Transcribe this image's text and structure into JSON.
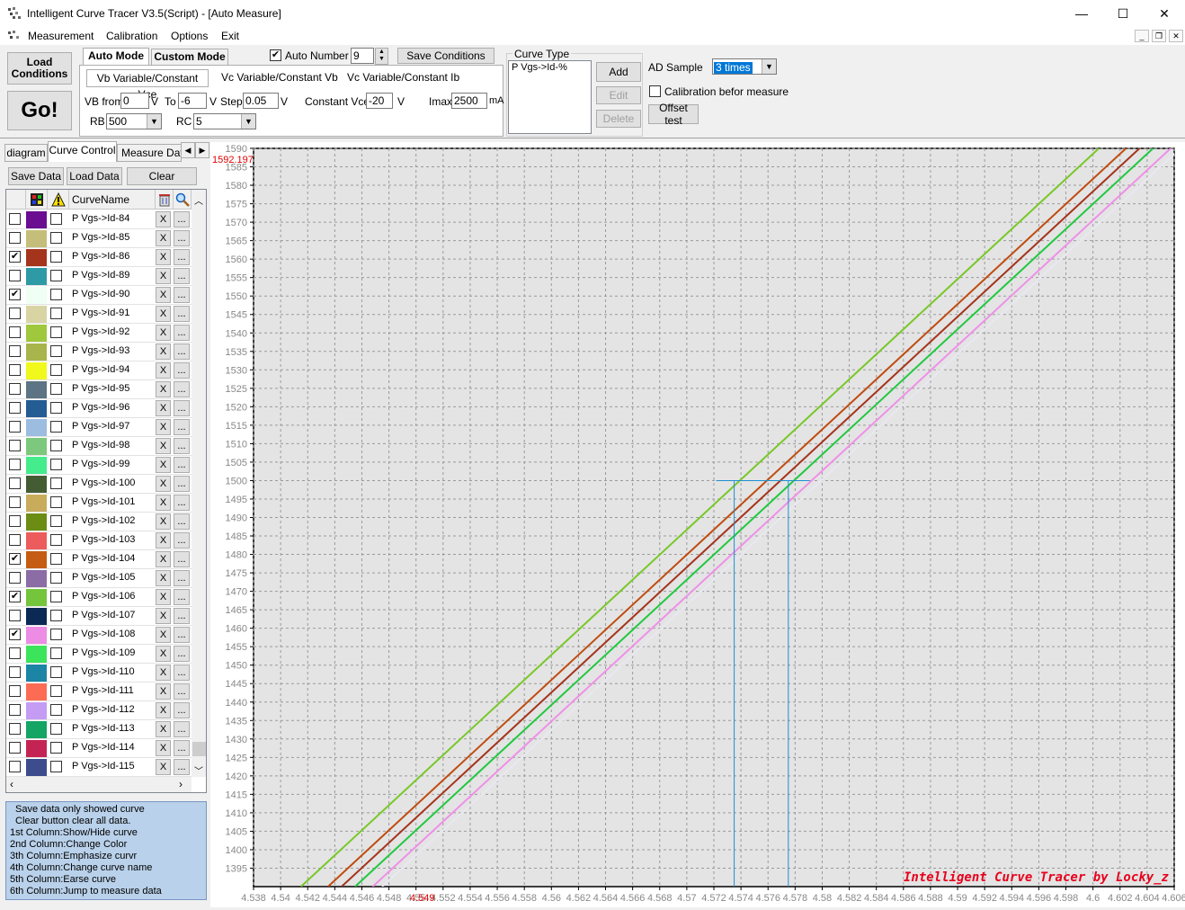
{
  "window": {
    "title": "Intelligent Curve Tracer V3.5(Script) - [Auto Measure]",
    "minimize": "—",
    "maximize": "☐",
    "close": "✕"
  },
  "menu": [
    "Measurement",
    "Calibration",
    "Options",
    "Exit"
  ],
  "toolbar": {
    "load_conditions": "Load Conditions",
    "go": "Go!",
    "auto_mode": "Auto Mode",
    "custom_mode": "Custom Mode",
    "auto_number_label": "Auto Number",
    "auto_number_checked": true,
    "auto_number_value": "9",
    "save_conditions": "Save Conditions",
    "mode_tabs": [
      "Vb Variable/Constant Vce",
      "Vc Variable/Constant Vb",
      "Vc Variable/Constant Ib"
    ],
    "vb_from_label": "VB from",
    "vb_from": "0",
    "v1": "V",
    "to_label": "To",
    "to_value": "-6",
    "v2": "V",
    "step_label": "Step",
    "step_value": "0.05",
    "v3": "V",
    "constant_vce_label": "Constant Vce",
    "constant_vce": "-20",
    "v4": "V",
    "imax_label": "Imax",
    "imax": "2500",
    "imax_unit": "mA",
    "rb_label": "RB",
    "rb_value": "500",
    "rc_label": "RC",
    "rc_value": "5",
    "curve_type_title": "Curve Type",
    "curve_type_item": "P Vgs->Id-%",
    "add": "Add",
    "edit": "Edit",
    "delete": "Delete",
    "ad_sample_label": "AD Sample",
    "ad_sample_value": "3 times",
    "calibration_label": "Calibration befor measure",
    "offset_test": "Offset test"
  },
  "left_tabs": [
    "diagram",
    "Curve Control",
    "Measure Data"
  ],
  "left_buttons": {
    "save_data": "Save Data",
    "load_data": "Load Data",
    "clear": "Clear"
  },
  "grid_header": {
    "name": "CurveName"
  },
  "curves": [
    {
      "name": "P Vgs->Id-84",
      "color": "#6a0d91",
      "checked": false
    },
    {
      "name": "P Vgs->Id-85",
      "color": "#c4be7a",
      "checked": false
    },
    {
      "name": "P Vgs->Id-86",
      "color": "#a4341c",
      "checked": true
    },
    {
      "name": "P Vgs->Id-89",
      "color": "#2e9aa6",
      "checked": false
    },
    {
      "name": "P Vgs->Id-90",
      "color": "#f0fff4",
      "checked": true
    },
    {
      "name": "P Vgs->Id-91",
      "color": "#d8d4a4",
      "checked": false
    },
    {
      "name": "P Vgs->Id-92",
      "color": "#a0c83c",
      "checked": false
    },
    {
      "name": "P Vgs->Id-93",
      "color": "#a8b44c",
      "checked": false
    },
    {
      "name": "P Vgs->Id-94",
      "color": "#f0f81c",
      "checked": false
    },
    {
      "name": "P Vgs->Id-95",
      "color": "#5c7484",
      "checked": false
    },
    {
      "name": "P Vgs->Id-96",
      "color": "#245c94",
      "checked": false
    },
    {
      "name": "P Vgs->Id-97",
      "color": "#9cbce0",
      "checked": false
    },
    {
      "name": "P Vgs->Id-98",
      "color": "#7cc87c",
      "checked": false
    },
    {
      "name": "P Vgs->Id-99",
      "color": "#44ec8c",
      "checked": false
    },
    {
      "name": "P Vgs->Id-100",
      "color": "#445c34",
      "checked": false
    },
    {
      "name": "P Vgs->Id-101",
      "color": "#c8ac5c",
      "checked": false
    },
    {
      "name": "P Vgs->Id-102",
      "color": "#6c8c14",
      "checked": false
    },
    {
      "name": "P Vgs->Id-103",
      "color": "#ec5c5c",
      "checked": false
    },
    {
      "name": "P Vgs->Id-104",
      "color": "#c45c14",
      "checked": true
    },
    {
      "name": "P Vgs->Id-105",
      "color": "#8c6ca4",
      "checked": false
    },
    {
      "name": "P Vgs->Id-106",
      "color": "#74c43c",
      "checked": true
    },
    {
      "name": "P Vgs->Id-107",
      "color": "#0c2854",
      "checked": false
    },
    {
      "name": "P Vgs->Id-108",
      "color": "#ec8ce4",
      "checked": true
    },
    {
      "name": "P Vgs->Id-109",
      "color": "#3ce45c",
      "checked": false
    },
    {
      "name": "P Vgs->Id-110",
      "color": "#1c84a4",
      "checked": false
    },
    {
      "name": "P Vgs->Id-111",
      "color": "#fc6c54",
      "checked": false
    },
    {
      "name": "P Vgs->Id-112",
      "color": "#c49cf4",
      "checked": false
    },
    {
      "name": "P Vgs->Id-113",
      "color": "#14a464",
      "checked": false
    },
    {
      "name": "P Vgs->Id-114",
      "color": "#c42454",
      "checked": false
    },
    {
      "name": "P Vgs->Id-115",
      "color": "#3c4c8c",
      "checked": false
    }
  ],
  "row_buttons": {
    "erase": "X",
    "jump": "..."
  },
  "help_lines": [
    "Save data only showed curve",
    "Clear button clear all data.",
    "1st Column:Show/Hide curve",
    "2nd Column:Change Color",
    "3th Column:Emphasize curvr",
    "4th Column:Change curve name",
    "5th Column:Earse curve",
    "6th Column:Jump to measure data"
  ],
  "chart_data": {
    "type": "line",
    "xlim": [
      4.538,
      4.606
    ],
    "ylim": [
      1390,
      1590
    ],
    "x_ticks": [
      4.538,
      4.54,
      4.542,
      4.544,
      4.546,
      4.548,
      4.55,
      4.552,
      4.554,
      4.556,
      4.558,
      4.56,
      4.562,
      4.564,
      4.566,
      4.568,
      4.57,
      4.572,
      4.574,
      4.576,
      4.578,
      4.58,
      4.582,
      4.584,
      4.586,
      4.588,
      4.59,
      4.592,
      4.594,
      4.596,
      4.598,
      4.6,
      4.602,
      4.604,
      4.606
    ],
    "y_ticks": [
      1395,
      1400,
      1405,
      1410,
      1415,
      1420,
      1425,
      1430,
      1435,
      1440,
      1445,
      1450,
      1455,
      1460,
      1465,
      1470,
      1475,
      1480,
      1485,
      1490,
      1495,
      1500,
      1505,
      1510,
      1515,
      1520,
      1525,
      1530,
      1535,
      1540,
      1545,
      1550,
      1550,
      1555,
      1560,
      1565,
      1570,
      1575,
      1580,
      1585,
      1590
    ],
    "top_left_readout": "1592.197",
    "cursor_x_readout": "4.549",
    "cursor_level": 1500,
    "cursor_x1": 4.5735,
    "cursor_x2": 4.5775,
    "grid": true,
    "series": [
      {
        "color": "#78c828",
        "x": [
          4.5415,
          4.6025
        ],
        "y": [
          1390,
          1597
        ]
      },
      {
        "color": "#c04c10",
        "x": [
          4.5435,
          4.6045
        ],
        "y": [
          1390,
          1597
        ]
      },
      {
        "color": "#a4341c",
        "x": [
          4.5445,
          4.6055
        ],
        "y": [
          1390,
          1597
        ]
      },
      {
        "color": "#22c840",
        "x": [
          4.5455,
          4.6065
        ],
        "y": [
          1390,
          1597
        ]
      },
      {
        "color": "#ee90e8",
        "x": [
          4.5468,
          4.6078
        ],
        "y": [
          1390,
          1597
        ]
      },
      {
        "color": "#e8e8f0",
        "x": [
          4.5475,
          4.6085
        ],
        "y": [
          1390,
          1597
        ]
      }
    ],
    "signature": "Intelligent Curve Tracer by Locky_z"
  }
}
